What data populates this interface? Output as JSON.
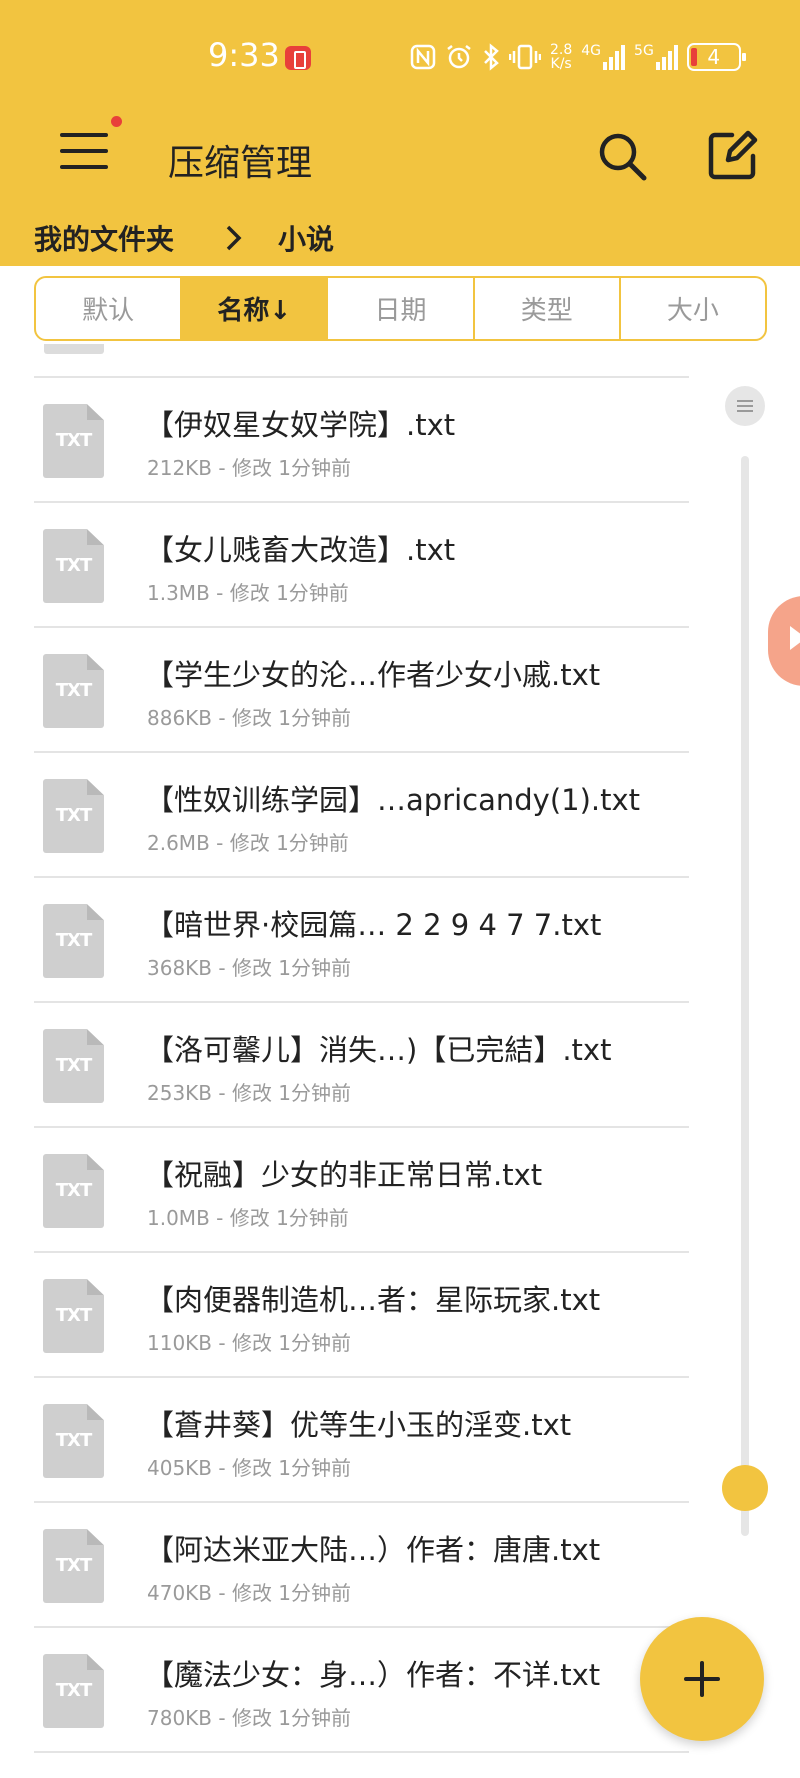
{
  "status_bar": {
    "time": "9:33",
    "icons": [
      "recording-icon",
      "nfc-icon",
      "alarm-icon",
      "bluetooth-icon",
      "vibrate-icon",
      "data-speed",
      "4g-signal-icon",
      "5g-signal-icon",
      "battery-icon"
    ],
    "data_speed_value": "2.8",
    "data_speed_unit": "K/s",
    "net_4g": "4G",
    "net_5g": "5G",
    "battery_level": "4"
  },
  "header": {
    "title": "压缩管理",
    "has_notification_dot": true,
    "background_color": "#f2c440"
  },
  "breadcrumb": {
    "root": "我的文件夹",
    "current": "小说"
  },
  "sort_tabs": [
    {
      "label": "默认",
      "active": false
    },
    {
      "label": "名称↓",
      "active": true
    },
    {
      "label": "日期",
      "active": false
    },
    {
      "label": "类型",
      "active": false
    },
    {
      "label": "大小",
      "active": false
    }
  ],
  "files": [
    {
      "icon_label": "TXT",
      "name": "【伊奴星女奴学院】.txt",
      "meta": "212KB - 修改 1分钟前"
    },
    {
      "icon_label": "TXT",
      "name": "【女儿贱畜大改造】.txt",
      "meta": "1.3MB - 修改 1分钟前"
    },
    {
      "icon_label": "TXT",
      "name": "【学生少女的沦…作者少女小戚.txt",
      "meta": "886KB - 修改 1分钟前"
    },
    {
      "icon_label": "TXT",
      "name": "【性奴训练学园】…apricandy(1).txt",
      "meta": "2.6MB - 修改 1分钟前"
    },
    {
      "icon_label": "TXT",
      "name": "【暗世界·校园篇… 2 2 9 4 7 7.txt",
      "meta": "368KB - 修改 1分钟前"
    },
    {
      "icon_label": "TXT",
      "name": "【洛可馨儿】消失…)【已完結】.txt",
      "meta": "253KB - 修改 1分钟前"
    },
    {
      "icon_label": "TXT",
      "name": "【祝融】少女的非正常日常.txt",
      "meta": "1.0MB - 修改 1分钟前"
    },
    {
      "icon_label": "TXT",
      "name": "【肉便器制造机…者：星际玩家.txt",
      "meta": "110KB - 修改 1分钟前"
    },
    {
      "icon_label": "TXT",
      "name": "【蒼井葵】优等生小玉的淫变.txt",
      "meta": "405KB - 修改 1分钟前"
    },
    {
      "icon_label": "TXT",
      "name": "【阿达米亚大陆…）作者：唐唐.txt",
      "meta": "470KB - 修改 1分钟前"
    },
    {
      "icon_label": "TXT",
      "name": "【魔法少女：身…）作者：不详.txt",
      "meta": "780KB - 修改 1分钟前"
    }
  ],
  "scroll_position": 0.88,
  "fab_icon": "plus-icon"
}
